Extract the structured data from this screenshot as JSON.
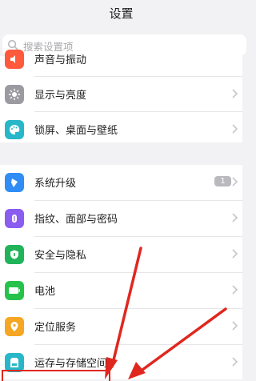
{
  "header": {
    "title": "设置"
  },
  "search": {
    "placeholder": "搜索设置项"
  },
  "groups": [
    {
      "items": [
        {
          "label": "声音与振动",
          "icon": "speaker-icon",
          "color": "#ff5a3c"
        },
        {
          "label": "显示与亮度",
          "icon": "sun-icon",
          "color": "#9a9aa0"
        },
        {
          "label": "锁屏、桌面与壁纸",
          "icon": "palette-icon",
          "color": "#27b7c8"
        }
      ]
    },
    {
      "items": [
        {
          "label": "系统升级",
          "icon": "system-update-icon",
          "color": "#2f8df5",
          "badge": "1"
        },
        {
          "label": "指纹、面部与密码",
          "icon": "fingerprint-icon",
          "color": "#8b5cf0"
        },
        {
          "label": "安全与隐私",
          "icon": "shield-icon",
          "color": "#20b35a"
        },
        {
          "label": "电池",
          "icon": "battery-icon",
          "color": "#27c24c"
        },
        {
          "label": "定位服务",
          "icon": "location-icon",
          "color": "#f5a623"
        },
        {
          "label": "运存与存储空间",
          "icon": "storage-icon",
          "color": "#27b7c8"
        }
      ]
    }
  ],
  "annotation": {
    "color": "#e0271f"
  }
}
